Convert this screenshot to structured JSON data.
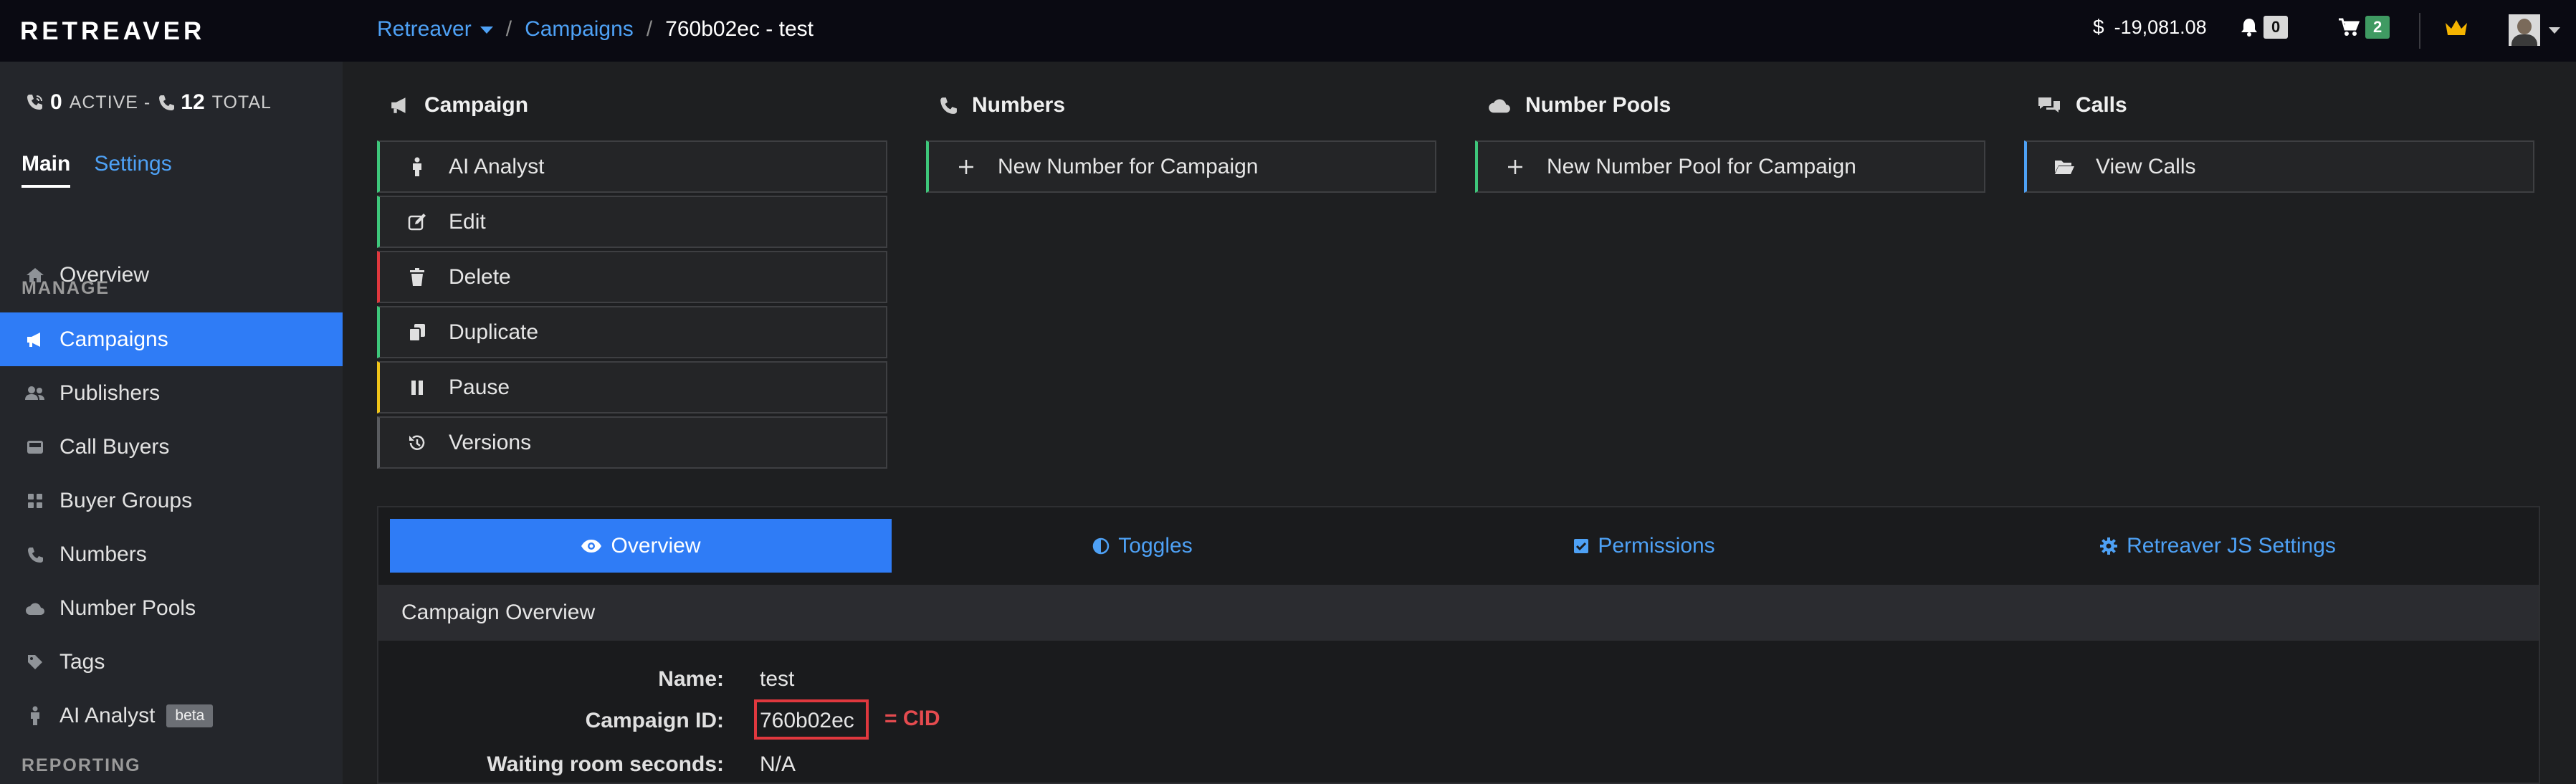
{
  "brand": {
    "logo": "RETREAVER"
  },
  "breadcrumb": {
    "account": "Retreaver",
    "section": "Campaigns",
    "current": "760b02ec - test",
    "sep": "/"
  },
  "header": {
    "balance_symbol": "$",
    "balance": "-19,081.08",
    "notifications": "0",
    "cart": "2"
  },
  "stats": {
    "active_count": "0",
    "active_label": "ACTIVE -",
    "total_count": "12",
    "total_label": "TOTAL"
  },
  "sidebar": {
    "tabs": {
      "main": "Main",
      "settings": "Settings"
    },
    "overview": "Overview",
    "manage_heading": "MANAGE",
    "items": [
      {
        "label": "Campaigns",
        "icon": "megaphone-icon"
      },
      {
        "label": "Publishers",
        "icon": "users-icon"
      },
      {
        "label": "Call Buyers",
        "icon": "inbox-icon"
      },
      {
        "label": "Buyer Groups",
        "icon": "grid-icon"
      },
      {
        "label": "Numbers",
        "icon": "phone-icon"
      },
      {
        "label": "Number Pools",
        "icon": "cloud-icon"
      },
      {
        "label": "Tags",
        "icon": "tag-icon"
      },
      {
        "label": "AI Analyst",
        "icon": "person-icon"
      }
    ],
    "beta": "beta",
    "reporting_heading": "REPORTING"
  },
  "sections": {
    "campaign": {
      "heading": "Campaign",
      "actions": [
        {
          "label": "AI Analyst",
          "color": "#3ec77b"
        },
        {
          "label": "Edit",
          "color": "#3ec77b"
        },
        {
          "label": "Delete",
          "color": "#e0383e"
        },
        {
          "label": "Duplicate",
          "color": "#3ec77b"
        },
        {
          "label": "Pause",
          "color": "#f0c419"
        },
        {
          "label": "Versions",
          "color": "#5a5c60"
        }
      ]
    },
    "numbers": {
      "heading": "Numbers",
      "action": "New Number for Campaign"
    },
    "pools": {
      "heading": "Number Pools",
      "action": "New Number Pool for Campaign"
    },
    "calls": {
      "heading": "Calls",
      "action": "View Calls"
    }
  },
  "panel_tabs": {
    "overview": "Overview",
    "toggles": "Toggles",
    "permissions": "Permissions",
    "js": "Retreaver JS Settings"
  },
  "overview": {
    "title": "Campaign Overview",
    "fields": [
      {
        "label": "Name:",
        "value": "test"
      },
      {
        "label": "Campaign ID:",
        "value": "760b02ec"
      },
      {
        "label": "Waiting room seconds:",
        "value": "N/A"
      }
    ],
    "annotation": "= CID"
  },
  "colors": {
    "accent": "#2f7cf6",
    "link": "#4ea1f5",
    "success": "#3ec77b",
    "danger": "#e0383e",
    "warning": "#f0c419",
    "crown": "#f5b400"
  }
}
